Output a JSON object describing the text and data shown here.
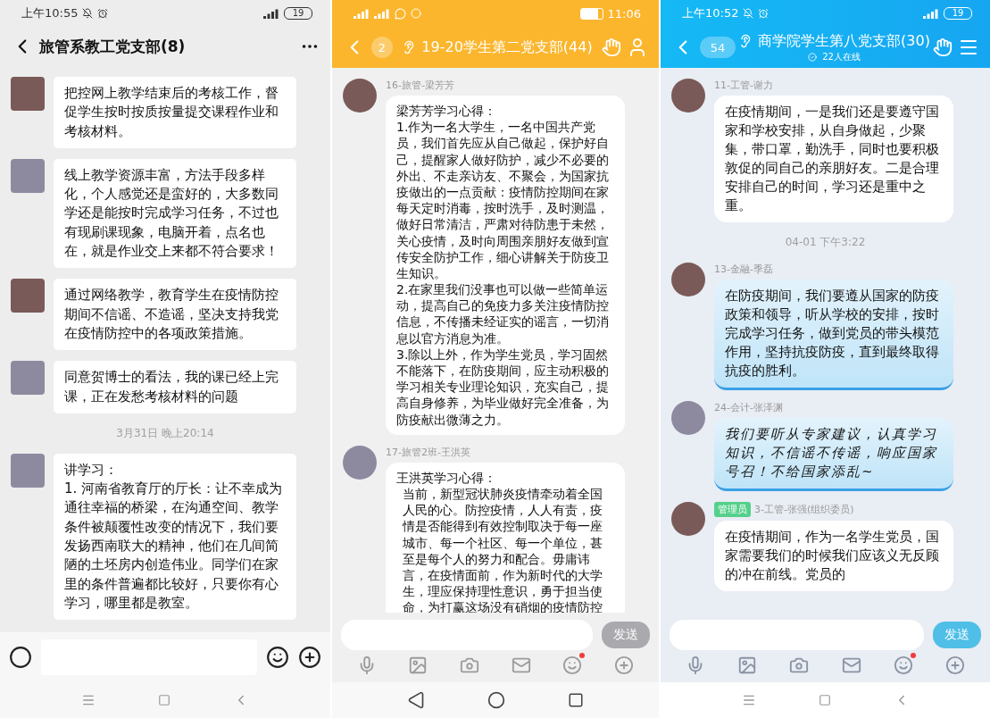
{
  "phones": [
    {
      "kind": "wechat",
      "status_bar": {
        "time": "上午10:55",
        "battery": "19"
      },
      "header": {
        "title": "旅管系教工党支部(8)"
      },
      "messages": [
        {
          "kind": "message",
          "paragraphs": [
            "把控网上教学结束后的考核工作，督促学生按时按质按量提交课程作业和考核材料。"
          ]
        },
        {
          "kind": "message",
          "paragraphs": [
            "线上教学资源丰富，方法手段多样化，个人感觉还是蛮好的，大多数同学还是能按时完成学习任务，不过也有现刷课现象，电脑开着，点名也在，就是作业交上来都不符合要求！"
          ]
        },
        {
          "kind": "message",
          "paragraphs": [
            "通过网络教学，教育学生在疫情防控期间不信谣、不造谣，坚决支持我党在疫情防控中的各项政策措施。"
          ]
        },
        {
          "kind": "message",
          "paragraphs": [
            "同意贺博士的看法，我的课已经上完课，正在发愁考核材料的问题"
          ]
        },
        {
          "kind": "timestamp",
          "text": "3月31日 晚上20:14"
        },
        {
          "kind": "message",
          "paragraphs": [
            "讲学习：",
            "1. 河南省教育厅的厅长：让不幸成为通往幸福的桥梁，在沟通空间、教学条件被颠覆性改变的情况下，我们要发扬西南联大的精神，他们在几间简陋的土坯房内创造伟业。同学们在家里的条件普遍都比较好，只要你有心学习，哪里都是教室。"
          ]
        }
      ]
    },
    {
      "kind": "qq-yellow",
      "status_bar": {
        "time": "11:06"
      },
      "header": {
        "unread": "2",
        "title": "19-20学生第二党支部(44)"
      },
      "messages": [
        {
          "kind": "message",
          "sender": "16-旅管-梁芳芳",
          "paragraphs": [
            "梁芳芳学习心得：",
            "1.作为一名大学生，一名中国共产党员，我们首先应从自己做起，保护好自己，提醒家人做好防护，减少不必要的外出、不走亲访友、不聚会，为国家抗疫做出的一点贡献：疫情防控期间在家每天定时消毒，按时洗手，及时测温，做好日常清洁，严肃对待防患于未然，关心疫情，及时向周围亲朋好友做到宣传安全防护工作，细心讲解关于防疫卫生知识。",
            "2.在家里我们没事也可以做一些简单运动，提高自己的免疫力多关注疫情防控信息，不传播未经证实的谣言，一切消息以官方消息为准。",
            "3.除以上外，作为学生党员，学习固然不能落下，在防疫期间，应主动积极的学习相关专业理论知识，充实自己，提高自身修养，为毕业做好完全准备，为防疫献出微薄之力。"
          ]
        },
        {
          "kind": "message",
          "sender": "17-旅管2班-王洪英",
          "paragraphs": [
            "王洪英学习心得：",
            "当前，新型冠状肺炎疫情牵动着全国人民的心。防控疫情，人人有责，疫情是否能得到有效控制取决于每一座城市、每一个社区、每一个单位，甚至是每个人的努力和配合。毋庸讳言，在疫情面前，作为新时代的大学生，理应保持理性意识，勇于担当使命，为打赢这场没有硝烟的疫情防控"
          ]
        }
      ],
      "input": {
        "send_label": "发送",
        "send_disabled": true,
        "emoji_dot": true
      }
    },
    {
      "kind": "qq-blue",
      "status_bar": {
        "time": "上午10:52",
        "battery": "19"
      },
      "header": {
        "unread": "54",
        "title": "商学院学生第八党支部(30)",
        "subtitle": "22人在线"
      },
      "messages": [
        {
          "kind": "message",
          "sender": "11-工管-谢力",
          "paragraphs": [
            "在疫情期间，一是我们还是要遵守国家和学校安排，从自身做起，少聚集，带口罩，勤洗手，同时也要积极敦促的同自己的亲朋好友。二是合理安排自己的时间，学习还是重中之重。"
          ]
        },
        {
          "kind": "timestamp",
          "text": "04-01 下午3:22"
        },
        {
          "kind": "ocean-message",
          "sender": "13-金融-季磊",
          "paragraphs": [
            "在防疫期间，我们要遵从国家的防疫政策和领导，听从学校的安排，按时完成学习任务，做到党员的带头模范作用，坚持抗疫防疫，直到最终取得抗疫的胜利。"
          ]
        },
        {
          "kind": "handwritten-message",
          "sender": "24-会计-张泽渊",
          "paragraphs": [
            "我们要听从专家建议，认真学习知识，不信谣不传谣，响应国家号召！不给国家添乱~"
          ]
        },
        {
          "kind": "message",
          "tag": "管理员",
          "sender": "3-工管-张强(组织委员)",
          "paragraphs": [
            "在疫情期间，作为一名学生党员，国家需要我们的时候我们应该义无反顾的冲在前线。党员的"
          ]
        }
      ],
      "input": {
        "send_label": "发送",
        "send_disabled": true,
        "emoji_dot": true
      }
    }
  ]
}
